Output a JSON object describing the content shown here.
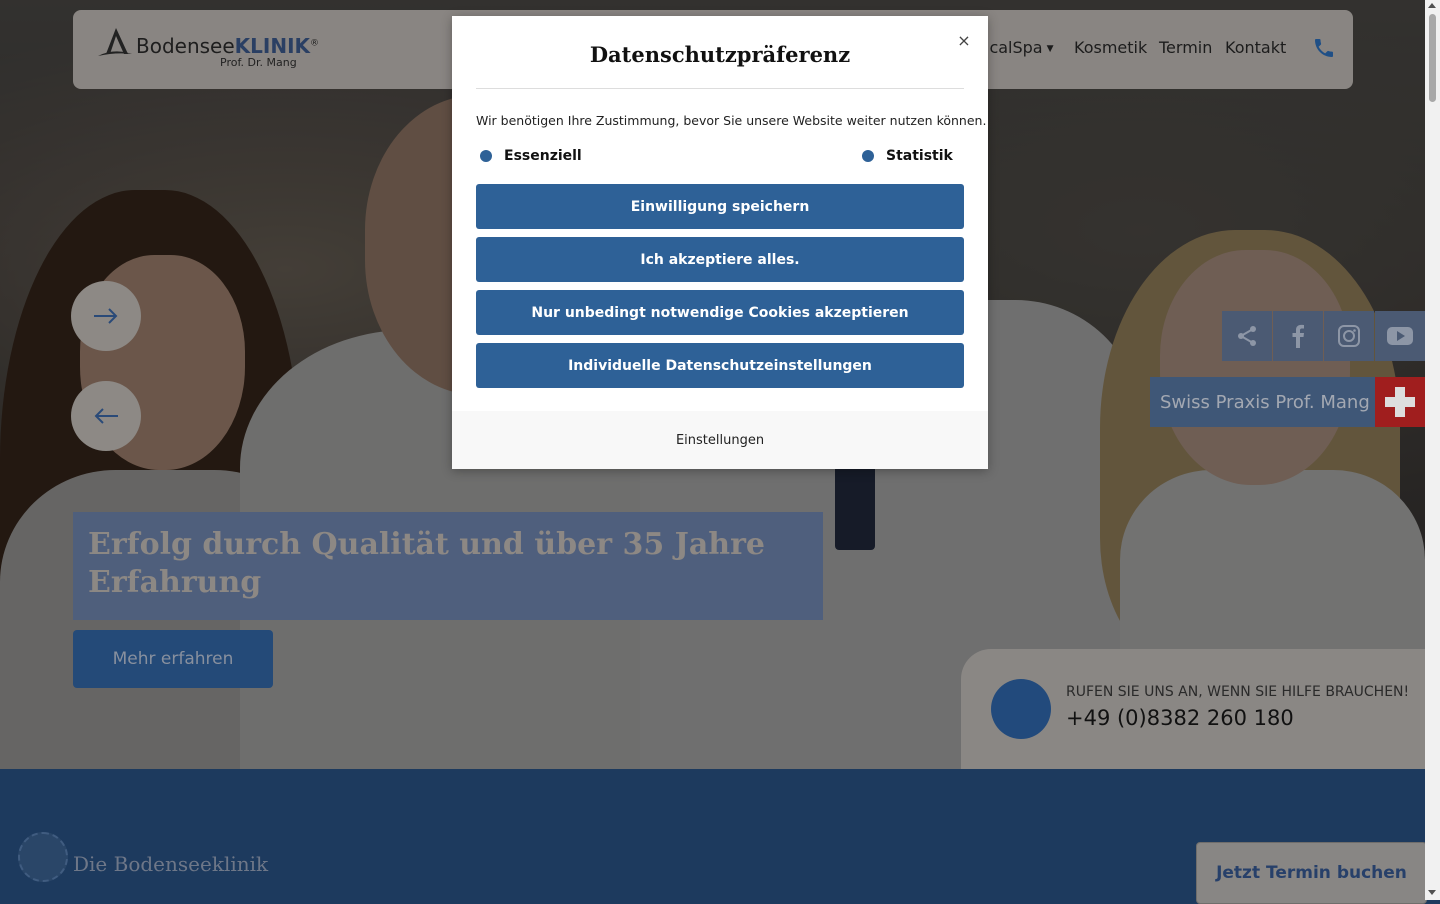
{
  "header": {
    "logo": {
      "brand_prefix": "Bodensee",
      "brand_main": "KLINIK",
      "registered": "®",
      "subtitle": "Prof. Dr. Mang"
    },
    "nav": [
      {
        "label": "icalSpa",
        "has_dropdown": true
      },
      {
        "label": "Kosmetik"
      },
      {
        "label": "Termin"
      },
      {
        "label": "Kontakt"
      }
    ],
    "phone_icon": "phone-icon"
  },
  "hero": {
    "caption": "Erfolg durch Qualität und über 35 Jahre Erfahrung",
    "more_button": "Mehr erfahren",
    "next_icon": "arrow-right-icon",
    "prev_icon": "arrow-left-icon"
  },
  "social": {
    "icons": [
      "share-icon",
      "facebook-icon",
      "instagram-icon",
      "youtube-icon"
    ]
  },
  "swiss_praxis": {
    "label": "Swiss Praxis Prof. Mang",
    "flag_icon": "swiss-flag-icon"
  },
  "callbox": {
    "question": "RUFEN SIE UNS AN, WENN SIE HILFE BRAUCHEN!",
    "number": "+49 (0)8382 260 180"
  },
  "lower": {
    "kicker": "Die Bodenseeklinik",
    "book_button": "Jetzt Termin buchen"
  },
  "modal": {
    "title": "Datenschutzpräferenz",
    "intro": "Wir benötigen Ihre Zustimmung, bevor Sie unsere Website weiter nutzen können.",
    "options": [
      {
        "label": "Essenziell",
        "checked": true
      },
      {
        "label": "Statistik",
        "checked": true
      }
    ],
    "buttons": [
      "Einwilligung speichern",
      "Ich akzeptiere alles.",
      "Nur unbedingt notwendige Cookies akzeptieren",
      "Individuelle Datenschutzeinstellungen"
    ],
    "footer_link": "Einstellungen",
    "accent_color": "#2e6197"
  }
}
